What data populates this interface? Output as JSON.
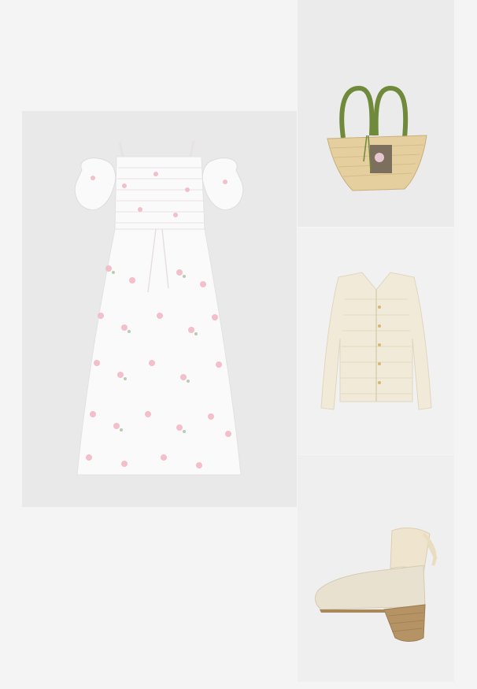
{
  "collage": {
    "items": [
      {
        "name": "floral-off-shoulder-midi-dress",
        "icon": "dress-icon"
      },
      {
        "name": "straw-tote-bag",
        "icon": "basket-bag-icon"
      },
      {
        "name": "crochet-cardigan",
        "icon": "cardigan-icon"
      },
      {
        "name": "espadrille-wedge",
        "icon": "shoe-icon"
      }
    ],
    "colors": {
      "page_background": "#f4f4f4",
      "dress_fabric": "#fbfafa",
      "dress_print": "#f2b9c6",
      "bag_straw": "#e6cf9e",
      "bag_handles": "#6f8a3a",
      "cardigan_knit": "#f1ead8",
      "shoe_canvas": "#e9e1cf",
      "shoe_jute": "#b59365"
    }
  }
}
